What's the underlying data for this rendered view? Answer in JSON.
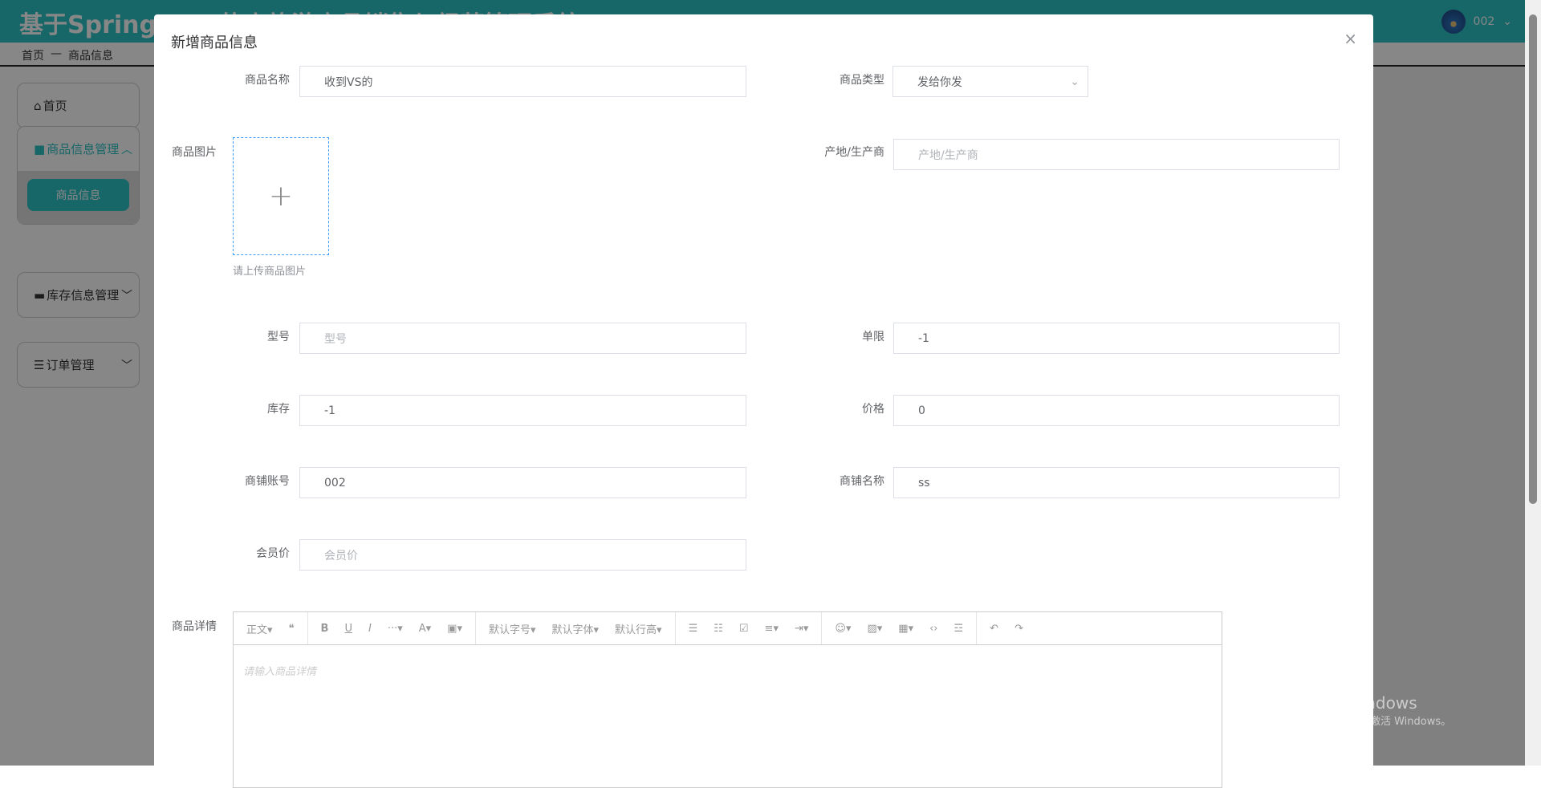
{
  "header": {
    "title": "基于SpringBoot的小旅游商品销售与经营管理系统",
    "user": "002"
  },
  "breadcrumb": {
    "home": "首页",
    "sep": "—",
    "current": "商品信息"
  },
  "sidebar": {
    "home": "首页",
    "product_mgmt": "商品信息管理",
    "product_info": "商品信息",
    "stock_mgmt": "库存信息管理",
    "order_mgmt": "订单管理"
  },
  "modal": {
    "title": "新增商品信息",
    "close": "×",
    "fields": {
      "name": {
        "label": "商品名称",
        "value": "收到VS的"
      },
      "type": {
        "label": "商品类型",
        "value": "发给你发"
      },
      "image": {
        "label": "商品图片",
        "hint": "请上传商品图片",
        "plus": "+"
      },
      "origin": {
        "label": "产地/生产商",
        "placeholder": "产地/生产商"
      },
      "model": {
        "label": "型号",
        "placeholder": "型号"
      },
      "limit": {
        "label": "单限",
        "value": "-1"
      },
      "stock": {
        "label": "库存",
        "value": "-1"
      },
      "price": {
        "label": "价格",
        "value": "0"
      },
      "shop_account": {
        "label": "商铺账号",
        "value": "002"
      },
      "shop_name": {
        "label": "商铺名称",
        "value": "ss"
      },
      "member_price": {
        "label": "会员价",
        "placeholder": "会员价"
      },
      "detail": {
        "label": "商品详情",
        "placeholder": "请输入商品详情"
      }
    },
    "toolbar": [
      "正文▾",
      "❝",
      "B",
      "U",
      "I",
      "···▾",
      "A▾",
      "▣▾",
      "默认字号▾",
      "默认字体▾",
      "默认行高▾",
      "☰",
      "☷",
      "☑",
      "≡▾",
      "⇥▾",
      "☺▾",
      "▨▾",
      "▦▾",
      "‹›",
      "☲",
      "↶",
      "↷"
    ]
  },
  "watermark": {
    "line1": "激活 Windows",
    "line2": "转到\"设置\"以激活 Windows。"
  }
}
